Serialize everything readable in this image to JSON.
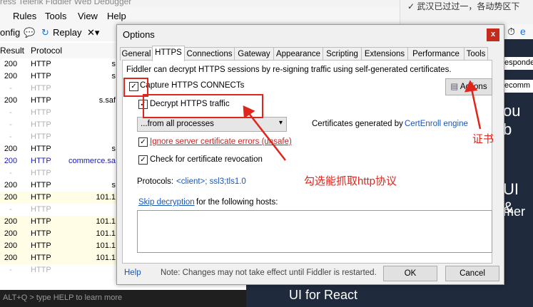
{
  "background_app": {
    "title_fragment": "ress Telerik Fiddler Web Debugger",
    "menu": [
      "Rules",
      "Tools",
      "View",
      "Help"
    ],
    "toolbar": {
      "config_fragment": "onfig",
      "replay": "Replay",
      "remove": "✕▾"
    },
    "columns": [
      "Result",
      "Protocol"
    ],
    "rows": [
      {
        "result": "200",
        "protocol": "HTTP",
        "host": "s",
        "style": "normal"
      },
      {
        "result": "200",
        "protocol": "HTTP",
        "host": "s",
        "style": "normal"
      },
      {
        "result": "-",
        "protocol": "HTTP",
        "host": "",
        "style": "gray"
      },
      {
        "result": "200",
        "protocol": "HTTP",
        "host": "s.saf",
        "style": "normal"
      },
      {
        "result": "-",
        "protocol": "HTTP",
        "host": "",
        "style": "gray"
      },
      {
        "result": "-",
        "protocol": "HTTP",
        "host": "",
        "style": "gray"
      },
      {
        "result": "-",
        "protocol": "HTTP",
        "host": "",
        "style": "gray"
      },
      {
        "result": "200",
        "protocol": "HTTP",
        "host": "s",
        "style": "normal"
      },
      {
        "result": "200",
        "protocol": "HTTP",
        "host": "commerce.sa",
        "style": "blue"
      },
      {
        "result": "-",
        "protocol": "HTTP",
        "host": "",
        "style": "gray"
      },
      {
        "result": "200",
        "protocol": "HTTP",
        "host": "s",
        "style": "normal"
      },
      {
        "result": "200",
        "protocol": "HTTP",
        "host": "101.1",
        "style": "yellow"
      },
      {
        "result": "-",
        "protocol": "HTTP",
        "host": "",
        "style": "gray"
      },
      {
        "result": "200",
        "protocol": "HTTP",
        "host": "101.1",
        "style": "yellow"
      },
      {
        "result": "200",
        "protocol": "HTTP",
        "host": "101.1",
        "style": "yellow"
      },
      {
        "result": "200",
        "protocol": "HTTP",
        "host": "101.1",
        "style": "yellow"
      },
      {
        "result": "200",
        "protocol": "HTTP",
        "host": "101.1",
        "style": "yellow"
      },
      {
        "result": "-",
        "protocol": "HTTP",
        "host": "",
        "style": "gray"
      }
    ],
    "quickexec": "ALT+Q > type HELP to learn more",
    "right_panel_text": [
      "ou b",
      "UI &",
      "mer"
    ],
    "bottom_text": "UI for React",
    "side_tab": "esponde",
    "side_tab2": "ecomm",
    "notification_fragment": "✓ 武汉已过过一，各动势区下"
  },
  "dialog": {
    "title": "Options",
    "close": "x",
    "tabs": [
      "General",
      "HTTPS",
      "Connections",
      "Gateway",
      "Appearance",
      "Scripting",
      "Extensions",
      "Performance",
      "Tools"
    ],
    "active_tab": "HTTPS",
    "intro": "Fiddler can decrypt HTTPS sessions by re-signing traffic using self-generated certificates.",
    "capture_label": "Capture HTTPS CONNECTs",
    "actions_button": "Actions",
    "decrypt_label": "Decrypt HTTPS traffic",
    "process_select": "...from all processes",
    "cert_text": "Certificates generated by",
    "cert_engine": "CertEnroll engine",
    "ignore_label": "Ignore server certificate errors (unsafe)",
    "revocation_label": "Check for certificate revocation",
    "protocols_label": "Protocols:",
    "protocols_value": "<client>; ssl3;tls1.0",
    "skip_link": "Skip decryption",
    "skip_rest": "for the following hosts:",
    "help_link": "Help",
    "note": "Note: Changes may not take effect until Fiddler is restarted.",
    "ok": "OK",
    "cancel": "Cancel"
  },
  "annotations": {
    "cert_label": "证书",
    "http_label": "勾选能抓取http协议",
    "color": "#e0251c"
  }
}
